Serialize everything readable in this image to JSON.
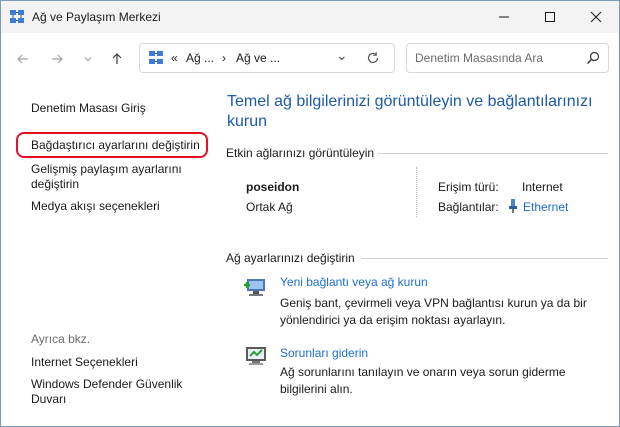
{
  "window": {
    "title": "Ağ ve Paylaşım Merkezi"
  },
  "address": {
    "sep": "«",
    "crumb1": "Ağ ...",
    "arrow": "›",
    "crumb2": "Ağ ve ...",
    "dropdown": "⌄"
  },
  "search": {
    "placeholder": "Denetim Masasında Ara"
  },
  "sidebar": {
    "home": "Denetim Masası Giriş",
    "adapter": "Bağdaştırıcı ayarlarını değiştirin",
    "advanced_line1": "Gelişmiş paylaşım ayarlarını",
    "advanced_line2": "değiştirin",
    "media": "Medya akışı seçenekleri",
    "see_also": "Ayrıca bkz.",
    "internet_options": "Internet Seçenekleri",
    "defender_line1": "Windows Defender Güvenlik",
    "defender_line2": "Duvarı"
  },
  "main": {
    "heading": "Temel ağ bilgilerinizi görüntüleyin ve bağlantılarınızı kurun",
    "active_section": "Etkin ağlarınızı görüntüleyin",
    "network_name": "poseidon",
    "network_type": "Ortak Ağ",
    "access_label": "Erişim türü:",
    "access_value": "Internet",
    "connections_label": "Bağlantılar:",
    "connections_value": "Ethernet",
    "change_section": "Ağ ayarlarınızı değiştirin",
    "task1_link": "Yeni bağlantı veya ağ kurun",
    "task1_desc": "Geniş bant, çevirmeli veya VPN bağlantısı kurun ya da bir yönlendirici ya da erişim noktası ayarlayın.",
    "task2_link": "Sorunları giderin",
    "task2_desc": "Ağ sorunlarını tanılayın ve onarın veya sorun giderme bilgilerini alın."
  },
  "icons": {
    "back": "arrow-left",
    "forward": "arrow-right",
    "recent": "chevron-down",
    "up": "arrow-up",
    "refresh": "refresh",
    "search": "magnifier",
    "minimize": "minimize",
    "maximize": "maximize",
    "close": "close"
  },
  "colors": {
    "link": "#1e6ec8",
    "heading": "#1e5aa8",
    "highlight": "#e81123",
    "titlebar": "#f3f3f3"
  }
}
